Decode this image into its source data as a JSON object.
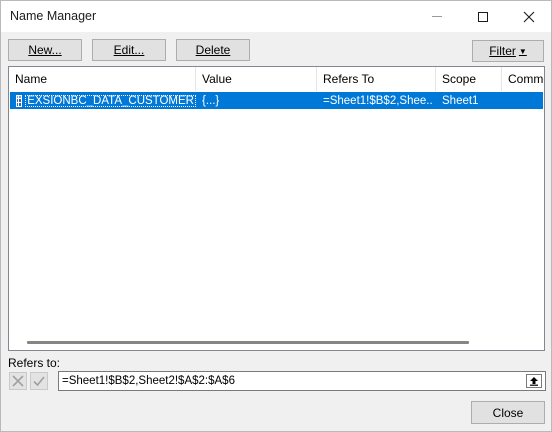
{
  "window": {
    "title": "Name Manager"
  },
  "toolbar": {
    "new_label": "New...",
    "edit_label": "Edit...",
    "delete_label": "Delete",
    "filter_label": "Filter"
  },
  "list": {
    "columns": [
      "Name",
      "Value",
      "Refers To",
      "Scope",
      "Comme"
    ],
    "rows": [
      {
        "name": "EXSIONBC_DATA_CUSTOMER",
        "value": "{...}",
        "refers_to": "=Sheet1!$B$2,Shee...",
        "scope": "Sheet1",
        "comment": "",
        "selected": true
      }
    ]
  },
  "refers_to": {
    "label": "Refers to:",
    "value": "=Sheet1!$B$2,Sheet2!$A$2:$A$6"
  },
  "footer": {
    "close_label": "Close"
  },
  "colors": {
    "selection": "#0078d7",
    "window_bg": "#f0f0f0",
    "button_bg": "#e1e1e1"
  },
  "icons": {
    "minimize": "minimize-icon",
    "maximize": "maximize-icon",
    "close": "close-icon",
    "range": "range-grid-icon",
    "cancel": "cancel-x-icon",
    "confirm": "checkmark-icon",
    "collapse": "collapse-dialog-icon"
  }
}
